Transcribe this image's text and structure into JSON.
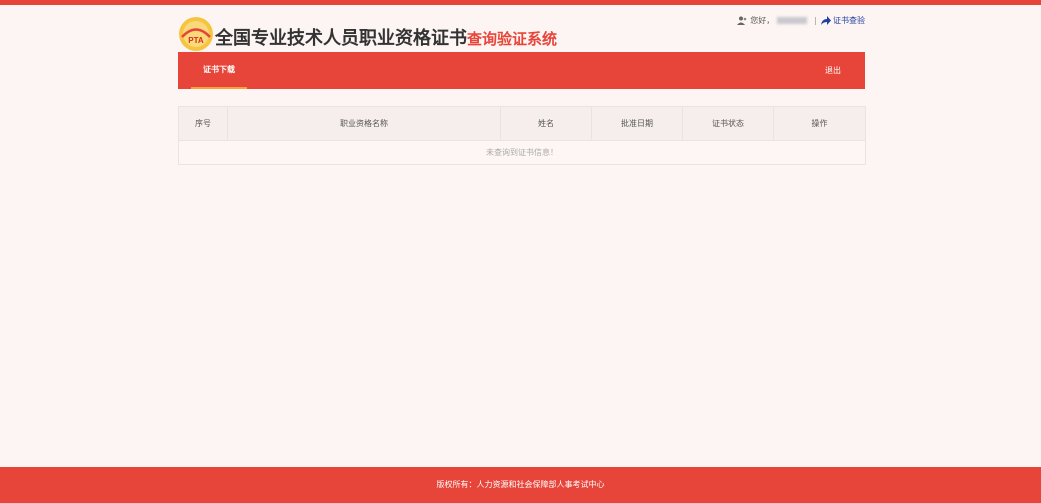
{
  "header": {
    "logo_text": "PTA",
    "title_main": "全国专业技术人员职业资格证书",
    "title_sub": "查询验证系统",
    "greeting": "您好，",
    "verify_link": "证书查验"
  },
  "nav": {
    "tabs": [
      {
        "label": "证书下载"
      }
    ],
    "logout": "退出"
  },
  "table": {
    "columns": [
      "序号",
      "职业资格名称",
      "姓名",
      "批准日期",
      "证书状态",
      "操作"
    ],
    "empty_message": "未查询到证书信息！"
  },
  "footer": {
    "text": "版权所有：人力资源和社会保障部人事考试中心"
  },
  "colors": {
    "primary": "#e8453a",
    "accent": "#f8a23c",
    "background": "#fdf5f3"
  }
}
